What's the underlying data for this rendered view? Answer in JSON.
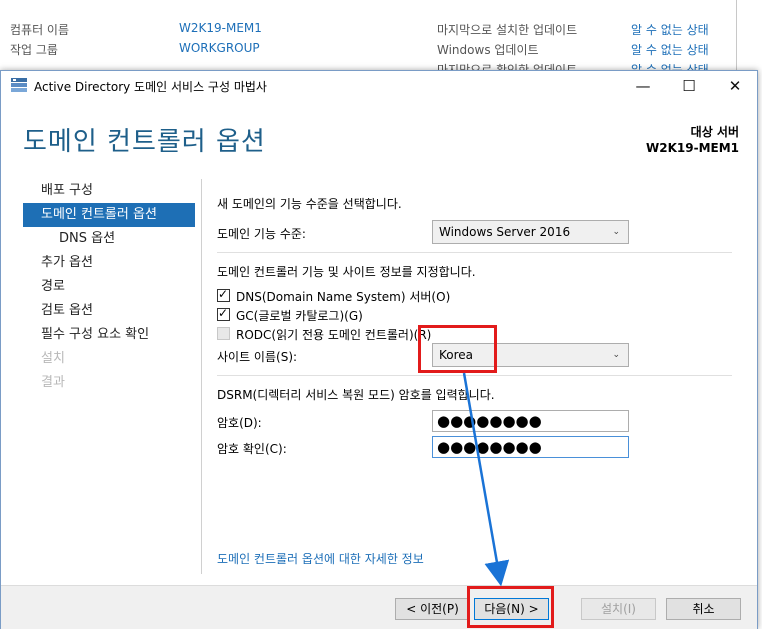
{
  "background": {
    "rows": [
      {
        "label": "컴퓨터 이름",
        "value": "W2K19-MEM1"
      },
      {
        "label": "작업 그룹",
        "value": "WORKGROUP"
      }
    ],
    "right_rows": [
      {
        "label": "마지막으로 설치한 업데이트",
        "value": "알 수 없는 상태"
      },
      {
        "label": "Windows 업데이트",
        "value": "알 수 없는 상태"
      },
      {
        "label": "마지막으로 확인한 업데이트",
        "value": "알 수 없는 상태"
      }
    ]
  },
  "window": {
    "title": "Active Directory 도메인 서비스 구성 마법사",
    "minimize": "—",
    "maximize": "☐",
    "close": "✕"
  },
  "header": {
    "title": "도메인 컨트롤러 옵션",
    "target_label": "대상 서버",
    "target_value": "W2K19-MEM1"
  },
  "nav": {
    "items": [
      {
        "label": "배포 구성",
        "state": "normal"
      },
      {
        "label": "도메인 컨트롤러 옵션",
        "state": "active"
      },
      {
        "label": "DNS 옵션",
        "state": "sub"
      },
      {
        "label": "추가 옵션",
        "state": "normal"
      },
      {
        "label": "경로",
        "state": "normal"
      },
      {
        "label": "검토 옵션",
        "state": "normal"
      },
      {
        "label": "필수 구성 요소 확인",
        "state": "normal"
      },
      {
        "label": "설치",
        "state": "disabled"
      },
      {
        "label": "결과",
        "state": "disabled"
      }
    ]
  },
  "content": {
    "func_level_heading": "새 도메인의 기능 수준을 선택합니다.",
    "domain_level_label": "도메인 기능 수준:",
    "domain_level_value": "Windows Server 2016",
    "capabilities_heading": "도메인 컨트롤러 기능 및 사이트 정보를 지정합니다.",
    "dns_label": "DNS(Domain Name System) 서버(O)",
    "gc_label": "GC(글로벌 카탈로그)(G)",
    "rodc_label": "RODC(읽기 전용 도메인 컨트롤러)(R)",
    "site_label": "사이트 이름(S):",
    "site_value": "Korea",
    "dsrm_heading": "DSRM(디렉터리 서비스 복원 모드) 암호를 입력합니다.",
    "password_label": "암호(D):",
    "password_value": "●●●●●●●●",
    "confirm_label": "암호 확인(C):",
    "confirm_value": "●●●●●●●●",
    "more_info_link": "도메인 컨트롤러 옵션에 대한 자세한 정보"
  },
  "footer": {
    "prev": "< 이전(P)",
    "next": "다음(N) >",
    "install": "설치(I)",
    "cancel": "취소"
  },
  "colors": {
    "accent": "#1e6fb5",
    "title": "#1e5f8a",
    "link": "#1d6fb8",
    "annotation": "#e21b1b",
    "arrow": "#1a73d6"
  }
}
